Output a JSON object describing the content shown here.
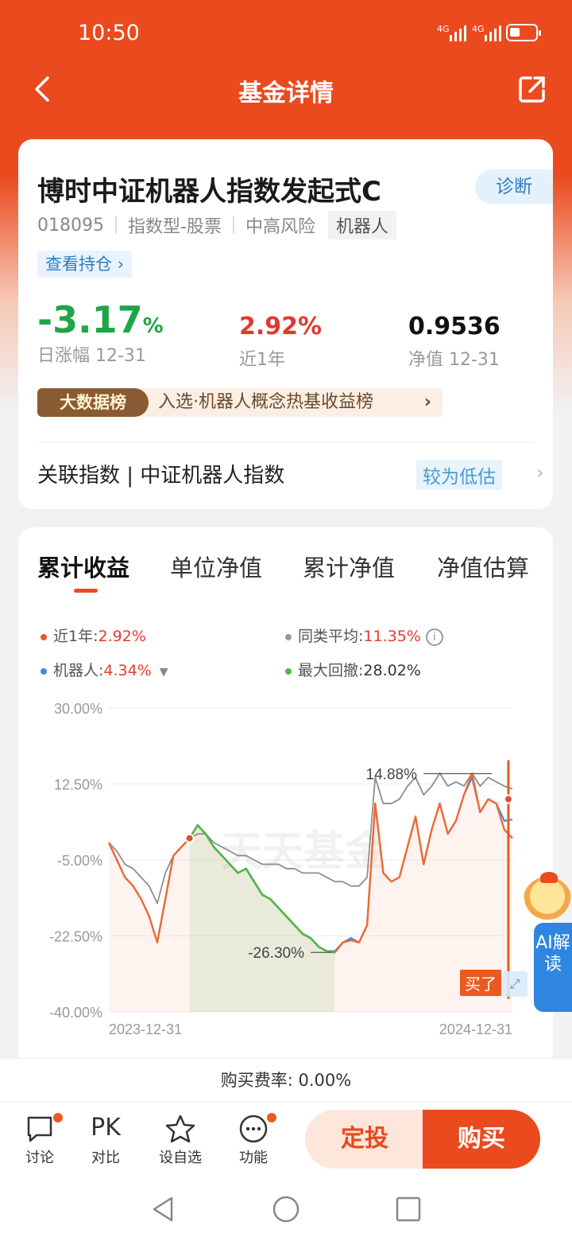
{
  "status": {
    "time": "10:50",
    "signal1": "4G",
    "signal2": "4G"
  },
  "nav": {
    "title": "基金详情"
  },
  "fund": {
    "name": "博时中证机器人指数发起式C",
    "diagnose_label": "诊断",
    "code": "018095",
    "type": "指数型-股票",
    "risk": "中高风险",
    "theme_tag": "机器人",
    "holdings_link": "查看持仓 ›",
    "daily_change_value": "-3.17",
    "daily_change_unit": "%",
    "daily_change_label": "日涨幅 12-31",
    "year_return": "2.92%",
    "year_return_label": "近1年",
    "nav_value": "0.9536",
    "nav_label": "净值 12-31",
    "ranking_badge": "大数据榜",
    "ranking_text": "入选·机器人概念热基收益榜",
    "ranking_arrow": "›",
    "index_row": "关联指数 | 中证机器人指数",
    "valuation_tag": "较为低估",
    "index_arrow": "›"
  },
  "tabs": [
    {
      "label": "累计收益"
    },
    {
      "label": "单位净值"
    },
    {
      "label": "累计净值"
    },
    {
      "label": "净值估算"
    }
  ],
  "legend": {
    "near_year_label": "近1年:",
    "near_year_value": "2.92%",
    "peer_label": "同类平均:",
    "peer_value": "11.35%",
    "robot_label": "机器人:",
    "robot_value": "4.34%",
    "drawdown_label": "最大回撤:",
    "drawdown_value": "28.02%"
  },
  "chart_data": {
    "type": "line",
    "title": "",
    "y_ticks": [
      "30.00%",
      "12.50%",
      "-5.00%",
      "-22.50%",
      "-40.00%"
    ],
    "ylim": [
      -40,
      30
    ],
    "x_labels": [
      "2023-12-31",
      "2024-12-31"
    ],
    "annotations": {
      "peak": "14.88%",
      "trough": "-26.30%"
    },
    "watermark": "天天基金",
    "buy_marker": "买了",
    "colors": {
      "fund": "#f06a33",
      "peer": "#8e8e8e",
      "robot": "#3b8ee0",
      "drawdown": "#4cb84c"
    },
    "x": [
      0,
      2,
      4,
      6,
      8,
      10,
      12,
      14,
      16,
      18,
      20,
      22,
      24,
      26,
      28,
      30,
      32,
      34,
      36,
      38,
      40,
      42,
      44,
      46,
      48,
      50,
      52,
      54,
      56,
      58,
      60,
      62,
      64,
      66,
      68,
      70,
      72,
      74,
      76,
      78,
      80,
      82,
      84,
      86,
      88,
      90,
      92,
      94,
      96,
      98,
      100
    ],
    "series": [
      {
        "name": "近1年",
        "values": [
          -1,
          -5,
          -9,
          -11,
          -14,
          -18,
          -24,
          -14,
          -4,
          -2,
          0,
          3,
          1,
          -2,
          -4,
          -6,
          -8,
          -7,
          -10,
          -13,
          -14,
          -16,
          -18,
          -20,
          -22,
          -23,
          -25,
          -26,
          -26.3,
          -24,
          -23.5,
          -24,
          -20,
          8,
          -8,
          -10,
          -9,
          -2,
          5,
          -6,
          2,
          8,
          1,
          4,
          10,
          14.88,
          6,
          9,
          8,
          2,
          0
        ]
      },
      {
        "name": "同类平均",
        "values": [
          -1,
          -3,
          -6,
          -7,
          -9,
          -11,
          -15,
          -8,
          -4,
          -2,
          0,
          1,
          1,
          -1,
          -2,
          -3,
          -4,
          -4,
          -5,
          -6,
          -6,
          -6,
          -7,
          -7,
          -8,
          -8,
          -8,
          -9,
          -10,
          -10,
          -11,
          -11,
          -9,
          14,
          8,
          8,
          9,
          12,
          14,
          10,
          12,
          15,
          12,
          13,
          12,
          15,
          12,
          14,
          13,
          12,
          11.35
        ]
      },
      {
        "name": "机器人",
        "values": [
          -1,
          -5,
          -9,
          -11,
          -14,
          -18,
          -24,
          -14,
          -4,
          -2,
          0,
          3,
          1,
          -2,
          -4,
          -6,
          -8,
          -7,
          -10,
          -13,
          -14,
          -16,
          -18,
          -20,
          -22,
          -23,
          -25,
          -26,
          -26,
          -24,
          -23,
          -24,
          -20,
          8,
          -8,
          -10,
          -9,
          -2,
          5,
          -6,
          2,
          8,
          1,
          4,
          10,
          14,
          6,
          9,
          8,
          4,
          4.34
        ]
      }
    ]
  },
  "fee": {
    "label": "购买费率:",
    "value": "0.00%"
  },
  "bottom": {
    "discuss": "讨论",
    "compare_icon": "PK",
    "compare": "对比",
    "watchlist": "设自选",
    "functions": "功能",
    "sip": "定投",
    "buy": "购买"
  },
  "ai": {
    "label": "AI解读"
  }
}
